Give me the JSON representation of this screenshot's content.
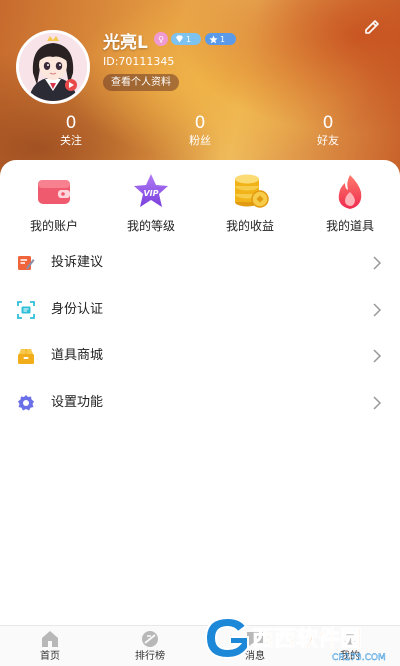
{
  "profile": {
    "username": "光亮L",
    "gender_symbol": "♀",
    "level_diamond": "1",
    "level_star": "1",
    "user_id": "ID:70111345",
    "view_profile_label": "查看个人资料"
  },
  "stats": [
    {
      "count": "0",
      "label": "关注"
    },
    {
      "count": "0",
      "label": "粉丝"
    },
    {
      "count": "0",
      "label": "好友"
    }
  ],
  "shortcuts": [
    {
      "label": "我的账户",
      "icon": "wallet-icon",
      "color": "#ef5a6e"
    },
    {
      "label": "我的等级",
      "icon": "vip-star-icon",
      "color": "#8a4fe0"
    },
    {
      "label": "我的收益",
      "icon": "coins-icon",
      "color": "#f2b318"
    },
    {
      "label": "我的道具",
      "icon": "flame-icon",
      "color": "#f2415c"
    }
  ],
  "vip_text": "VIP",
  "menu": [
    {
      "label": "投诉建议",
      "icon": "feedback-icon",
      "color": "#f0643c"
    },
    {
      "label": "身份认证",
      "icon": "scan-id-icon",
      "color": "#2fc0d8"
    },
    {
      "label": "道具商城",
      "icon": "shop-icon",
      "color": "#f2ae1a"
    },
    {
      "label": "设置功能",
      "icon": "settings-icon",
      "color": "#6b70e8"
    }
  ],
  "tabbar": [
    {
      "label": "首页",
      "icon": "home-icon"
    },
    {
      "label": "排行榜",
      "icon": "ranking-icon"
    },
    {
      "label": "消息",
      "icon": "message-icon"
    },
    {
      "label": "我的",
      "icon": "profile-icon"
    }
  ],
  "watermark": {
    "text": "西西软件园",
    "sub": "CR173.COM"
  }
}
